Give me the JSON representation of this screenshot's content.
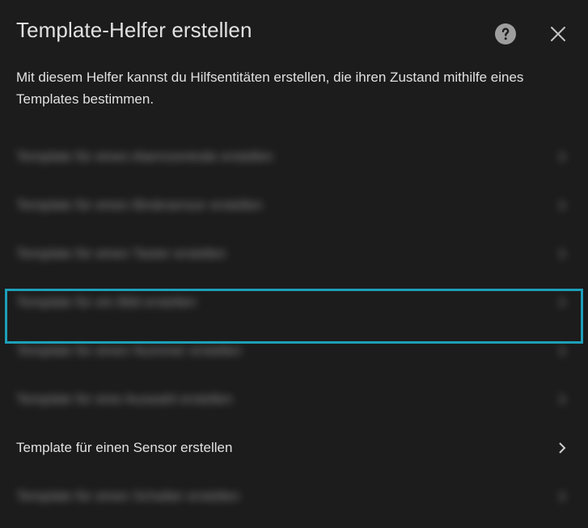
{
  "dialog": {
    "title": "Template-Helfer erstellen",
    "description": "Mit diesem Helfer kannst du Hilfsentitäten erstellen, die ihren Zustand mithilfe eines Templates bestimmen.",
    "help_icon": "help-circle-icon",
    "close_icon": "close-icon"
  },
  "options": [
    {
      "label": "Template für einen Alarmzentrale erstellen",
      "blurred": true
    },
    {
      "label": "Template für einen Binärsensor erstellen",
      "blurred": true
    },
    {
      "label": "Template für einen Taster erstellen",
      "blurred": true
    },
    {
      "label": "Template für ein Bild erstellen",
      "blurred": true
    },
    {
      "label": "Template für einen Nummer erstellen",
      "blurred": true
    },
    {
      "label": "Template für eine Auswahl erstellen",
      "blurred": true
    },
    {
      "label": "Template für einen Sensor erstellen",
      "blurred": false,
      "focused": true
    },
    {
      "label": "Template für einen Schalter erstellen",
      "blurred": true
    }
  ],
  "colors": {
    "background": "#1c1c1c",
    "text": "#e1e1e1",
    "focus": "#1d9fb8",
    "icon": "#9e9e9e"
  }
}
